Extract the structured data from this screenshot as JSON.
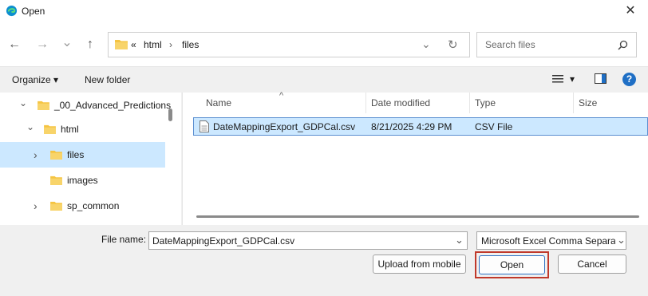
{
  "window": {
    "title": "Open",
    "close_glyph": "✕"
  },
  "nav": {
    "back_glyph": "←",
    "forward_glyph": "→",
    "recent_glyph": "⌄",
    "up_glyph": "↑"
  },
  "address": {
    "overflow": "«",
    "crumbs": [
      "html",
      "files"
    ],
    "sep": "›",
    "refresh_glyph": "↻",
    "dropdown_glyph": "⌄"
  },
  "search": {
    "placeholder": "Search files",
    "icon_glyph": "⚲"
  },
  "toolbar": {
    "organize_label": "Organize",
    "organize_caret": "▾",
    "new_folder_label": "New folder",
    "view_caret": "▾",
    "help_glyph": "?"
  },
  "tree": {
    "items": [
      {
        "label": "_00_Advanced_Predictions",
        "expander": "⌄"
      },
      {
        "label": "html",
        "expander": "⌄"
      },
      {
        "label": "files",
        "expander": "›"
      },
      {
        "label": "images",
        "expander": ""
      },
      {
        "label": "sp_common",
        "expander": "›"
      }
    ]
  },
  "list": {
    "sort_glyph": "^",
    "columns": [
      "Name",
      "Date modified",
      "Type",
      "Size"
    ],
    "rows": [
      {
        "name": "DateMappingExport_GDPCal.csv",
        "date": "8/21/2025 4:29 PM",
        "type": "CSV File",
        "size": ""
      }
    ]
  },
  "footer": {
    "filename_label": "File name:",
    "filename_value": "DateMappingExport_GDPCal.csv",
    "filetype_value": "Microsoft Excel Comma Separa",
    "dropdown_glyph": "⌄",
    "upload_label": "Upload from mobile",
    "open_label": "Open",
    "cancel_label": "Cancel"
  },
  "colors": {
    "accent": "#0067c0",
    "selection": "#cce8ff",
    "folder": "#f5c441",
    "highlight_outline": "#c0392b"
  }
}
